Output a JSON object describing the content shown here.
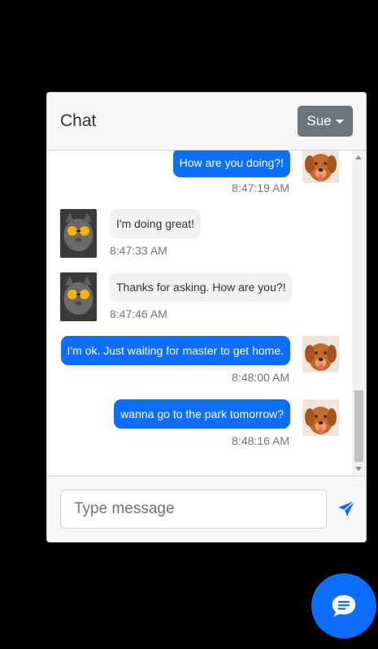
{
  "chat": {
    "title": "Chat",
    "current_user": "Sue",
    "input_placeholder": "Type message"
  },
  "messages": [
    {
      "sender": "Sue",
      "text": "How are you doing?!",
      "time": "8:47:19 AM",
      "direction": "outgoing"
    },
    {
      "sender": "cat",
      "text": "I'm doing great!",
      "time": "8:47:33 AM",
      "direction": "incoming"
    },
    {
      "sender": "cat",
      "text": "Thanks for asking. How are you?!",
      "time": "8:47:46 AM",
      "direction": "incoming"
    },
    {
      "sender": "Sue",
      "text": "I'm ok. Just waiting for master to get home.",
      "time": "8:48:00 AM",
      "direction": "outgoing"
    },
    {
      "sender": "Sue",
      "text": "wanna go to the park tomorrow?",
      "time": "8:48:16 AM",
      "direction": "outgoing"
    }
  ],
  "icons": {
    "send": "paper-plane-icon",
    "fab": "chat-bubble-icon",
    "dropdown": "caret-down-icon"
  },
  "colors": {
    "accent": "#0d6efd",
    "dropdown_bg": "#6c757d",
    "incoming_bubble": "#f1f1f1",
    "background": "#000000"
  }
}
